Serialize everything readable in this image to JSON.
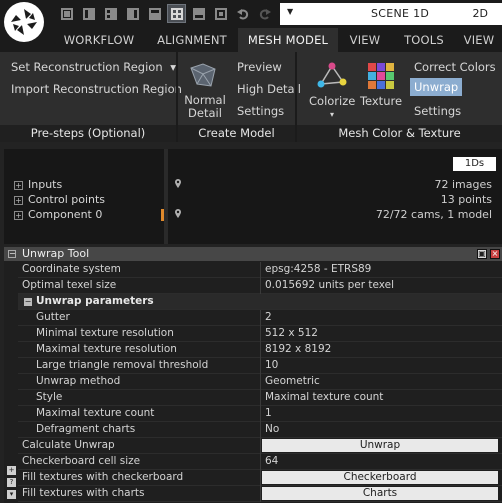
{
  "colors": {
    "background": "#232323",
    "ribbon": "#2e2e2e",
    "selected": "#8cadd0",
    "panel_header": "#474747"
  },
  "titlebar": {
    "quick_access_icons": [
      "workspace-1-icon",
      "workspace-2-icon",
      "workspace-3-icon",
      "workspace-4-icon",
      "workspace-5-icon",
      "layout-grid-icon",
      "workspace-6-icon",
      "workspace-7-icon",
      "undo-icon",
      "redo-icon"
    ],
    "scene_dropdown_arrow": "▼",
    "scene_label": "SCENE 1D",
    "scene_mode": "2D"
  },
  "tabs": [
    {
      "label": "WORKFLOW"
    },
    {
      "label": "ALIGNMENT"
    },
    {
      "label": "MESH MODEL"
    },
    {
      "label": "VIEW"
    },
    {
      "label": "TOOLS"
    },
    {
      "label": "VIEW"
    }
  ],
  "ribbon": {
    "presteps": {
      "set_region": "Set Reconstruction Region",
      "set_region_arrow": "▾",
      "import_region": "Import Reconstruction Region",
      "title": "Pre-steps (Optional)"
    },
    "create_model": {
      "normal_detail": "Normal Detail",
      "preview": "Preview",
      "high_detail": "High Detail",
      "settings": "Settings",
      "title": "Create Model"
    },
    "color_texture": {
      "colorize": "Colorize",
      "colorize_arrow": "▾",
      "texture": "Texture",
      "correct_colors": "Correct Colors",
      "unwrap": "Unwrap",
      "settings": "Settings",
      "title": "Mesh Color & Texture"
    }
  },
  "tree": {
    "badge": "1Ds",
    "rows": [
      {
        "label": "Inputs",
        "value": "72 images"
      },
      {
        "label": "Control points",
        "value": "13 points"
      },
      {
        "label": "Component 0",
        "value": "72/72 cams, 1 model"
      }
    ]
  },
  "unwrap_tool": {
    "title": "Unwrap Tool",
    "rows": {
      "coordinate_system": {
        "label": "Coordinate system",
        "value": "epsg:4258 - ETRS89"
      },
      "optimal_texel": {
        "label": "Optimal texel size",
        "value": "0.015692 units per texel"
      },
      "unwrap_params": {
        "label": "Unwrap parameters"
      },
      "gutter": {
        "label": "Gutter",
        "value": "2"
      },
      "min_res": {
        "label": "Minimal texture resolution",
        "value": "512 x 512"
      },
      "max_res": {
        "label": "Maximal texture resolution",
        "value": "8192 x 8192"
      },
      "large_tri": {
        "label": "Large triangle removal threshold",
        "value": "10"
      },
      "method": {
        "label": "Unwrap method",
        "value": "Geometric"
      },
      "style": {
        "label": "Style",
        "value": "Maximal texture count"
      },
      "max_count": {
        "label": "Maximal texture count",
        "value": "1"
      },
      "defragment": {
        "label": "Defragment charts",
        "value": "No"
      },
      "calculate": {
        "label": "Calculate Unwrap",
        "button": "Unwrap"
      },
      "checker_size": {
        "label": "Checkerboard cell size",
        "value": "64"
      },
      "fill_checker": {
        "label": "Fill textures with checkerboard",
        "button": "Checkerboard"
      },
      "fill_charts": {
        "label": "Fill textures with charts",
        "button": "Charts"
      }
    }
  }
}
